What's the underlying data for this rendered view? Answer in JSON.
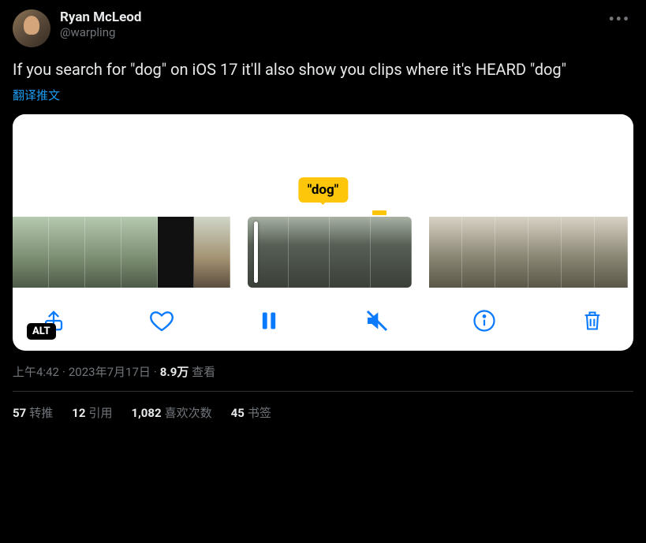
{
  "user": {
    "display_name": "Ryan McLeod",
    "handle": "@warpling"
  },
  "tweet_text": "If you search for \"dog\" on iOS 17 it'll also show you clips where it's HEARD \"dog\"",
  "translate_link": "翻译推文",
  "media": {
    "tooltip": "\"dog\"",
    "alt_badge": "ALT",
    "toolbar": {
      "share": "share-icon",
      "like": "heart-icon",
      "pause": "pause-icon",
      "mute": "mute-icon",
      "info": "info-icon",
      "trash": "trash-icon"
    }
  },
  "meta": {
    "time": "上午4:42",
    "date": "2023年7月17日",
    "views_count": "8.9万",
    "views_label": " 查看"
  },
  "stats": {
    "retweets": {
      "count": "57",
      "label": "转推"
    },
    "quotes": {
      "count": "12",
      "label": "引用"
    },
    "likes": {
      "count": "1,082",
      "label": "喜欢次数"
    },
    "bookmarks": {
      "count": "45",
      "label": "书签"
    }
  }
}
